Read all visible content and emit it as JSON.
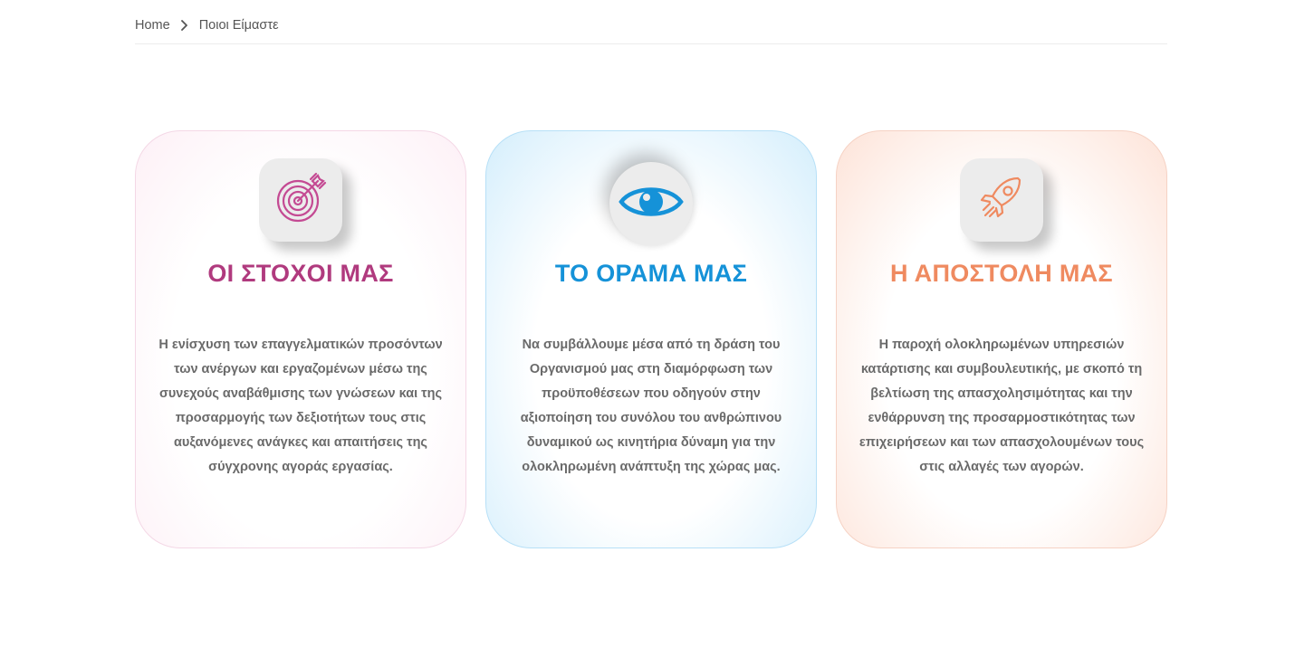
{
  "breadcrumb": {
    "home": "Home",
    "current": "Ποιοι Είμαστε"
  },
  "cards": [
    {
      "icon": "target-icon",
      "title": "ΟΙ ΣΤΟΧΟΙ ΜΑΣ",
      "color": "#b03a7e",
      "text": "Η ενίσχυση των επαγγελματικών προσόντων των ανέργων και εργαζομένων μέσω της συνεχούς αναβάθμισης των γνώσεων και της προσαρμογής των δεξιοτήτων τους στις αυξανόμενες ανάγκες και απαιτήσεις της σύγχρονης αγοράς εργασίας."
    },
    {
      "icon": "eye-icon",
      "title": "ΤΟ ΟΡΑΜΑ ΜΑΣ",
      "color": "#1592d8",
      "text": "Να συμβάλλουμε μέσα από τη δράση του Οργανισμού μας στη διαμόρφωση των προϋποθέσεων που οδηγούν στην αξιοποίηση του συνόλου του ανθρώπινου δυναμικού ως κινητήρια δύναμη για την ολοκληρωμένη ανάπτυξη της χώρας μας."
    },
    {
      "icon": "rocket-icon",
      "title": "Η ΑΠΟΣΤΟΛΗ ΜΑΣ",
      "color": "#ef8a60",
      "text": "Η παροχή ολοκληρωμένων υπηρεσιών κατάρτισης και συμβουλευτικής, με σκοπό τη βελτίωση της απασχολησιμότητας και την ενθάρρυνση της προσαρμοστικότητας των επιχειρήσεων και των απασχολουμένων τους στις αλλαγές των αγορών."
    }
  ]
}
